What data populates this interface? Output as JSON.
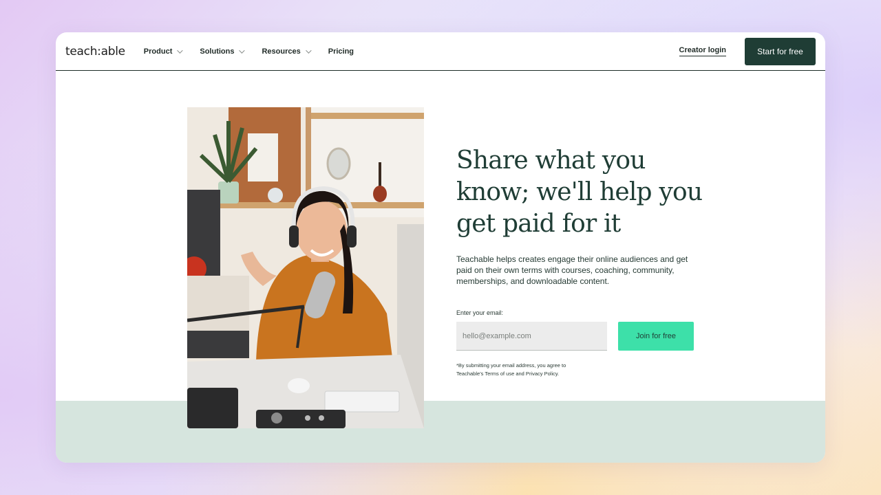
{
  "nav": {
    "logo": "teach:able",
    "items": [
      {
        "label": "Product",
        "dropdown": true
      },
      {
        "label": "Solutions",
        "dropdown": true
      },
      {
        "label": "Resources",
        "dropdown": true
      },
      {
        "label": "Pricing",
        "dropdown": false
      }
    ],
    "login_label": "Creator login",
    "cta_label": "Start for free"
  },
  "hero": {
    "headline": "Share what you know; we'll help you get paid for it",
    "description": "Teachable helps creates engage their online audiences and get paid on their own terms with courses, coaching, community, memberships, and downloadable content.",
    "email_label": "Enter your email:",
    "email_placeholder": "hello@example.com",
    "email_value": "",
    "join_label": "Join for free",
    "disclaimer": "*By submitting your email address, you agree to Teachable's Terms of use and Privacy Policy."
  },
  "colors": {
    "primary_dark": "#1f3d35",
    "accent_green": "#3de0a9",
    "strip_green": "#d6e5de"
  }
}
